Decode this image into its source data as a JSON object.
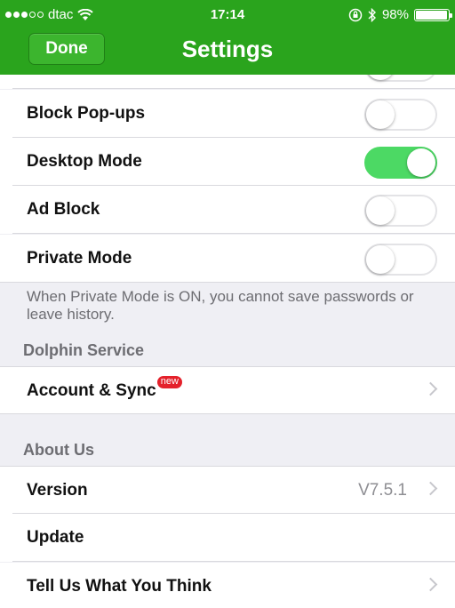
{
  "status": {
    "carrier": "dtac",
    "time": "17:14",
    "battery": "98%",
    "battery_level": 0.98
  },
  "nav": {
    "done_label": "Done",
    "title": "Settings"
  },
  "rows": {
    "block_popups": {
      "label": "Block Pop-ups",
      "on": false
    },
    "desktop_mode": {
      "label": "Desktop Mode",
      "on": true
    },
    "ad_block": {
      "label": "Ad Block",
      "on": false
    },
    "private_mode": {
      "label": "Private Mode",
      "on": false
    }
  },
  "private_note": "When Private Mode is ON, you cannot save passwords or leave history.",
  "sections": {
    "dolphin_service": "Dolphin Service",
    "about_us": "About Us"
  },
  "account_sync": {
    "label": "Account & Sync",
    "badge": "new"
  },
  "version": {
    "label": "Version",
    "value": "V7.5.1"
  },
  "update": {
    "label": "Update"
  },
  "feedback": {
    "label": "Tell Us What You Think"
  },
  "colors": {
    "brand_green": "#2aa41d",
    "toggle_on": "#4cd964",
    "badge_red": "#e4212b"
  }
}
